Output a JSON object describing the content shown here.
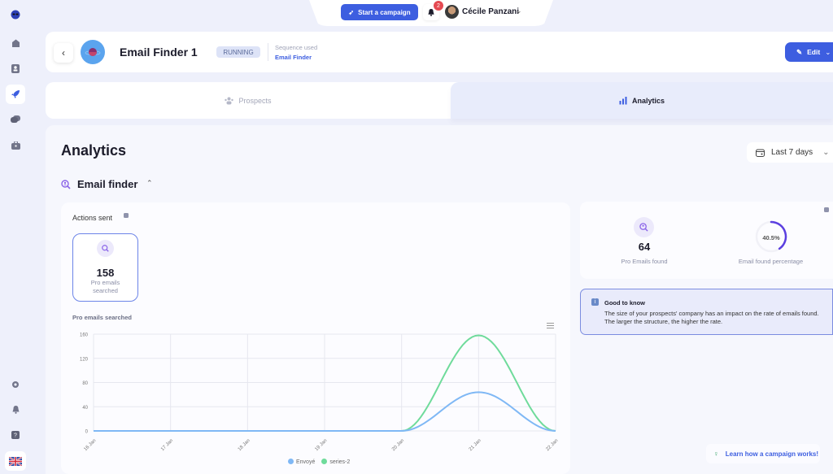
{
  "sidebar": {
    "items": [
      {
        "name": "logo-icon"
      },
      {
        "name": "home-icon"
      },
      {
        "name": "contacts-icon"
      },
      {
        "name": "campaigns-icon",
        "active": true
      },
      {
        "name": "messages-icon"
      },
      {
        "name": "toolbox-icon"
      }
    ],
    "bottom": [
      {
        "name": "settings-icon"
      },
      {
        "name": "notifications-icon"
      },
      {
        "name": "help-icon"
      },
      {
        "name": "language-flag-icon"
      }
    ]
  },
  "topbar": {
    "start_campaign_label": "Start a campaign",
    "notification_count": "2",
    "user_name": "Cécile Panzani"
  },
  "header": {
    "campaign_title": "Email Finder 1",
    "status": "RUNNING",
    "sequence_label": "Sequence used",
    "sequence_value": "Email Finder",
    "edit_label": "Edit"
  },
  "tabs": [
    {
      "label": "Prospects",
      "active": false
    },
    {
      "label": "Analytics",
      "active": true
    }
  ],
  "analytics": {
    "title": "Analytics",
    "date_range": "Last 7 days",
    "section_title": "Email finder",
    "actions_sent_title": "Actions sent",
    "stat": {
      "value": "158",
      "label": "Pro emails searched"
    },
    "chart_title": "Pro emails searched"
  },
  "summary": {
    "found_value": "64",
    "found_label": "Pro Emails found",
    "percentage_value": 40.5,
    "percentage_text": "40.5%",
    "percentage_label": "Email found percentage",
    "ring_color": "#5b3fe0"
  },
  "good_to_know": {
    "title": "Good to know",
    "text": "The size of your prospects' company has an impact on the rate of emails found. The larger the structure, the higher the rate."
  },
  "learn_link": "Learn how a campaign works!",
  "chart_data": {
    "type": "area",
    "title": "Pro emails searched",
    "x": [
      "16 Jan",
      "17 Jan",
      "18 Jan",
      "19 Jan",
      "20 Jan",
      "21 Jan",
      "22 Jan"
    ],
    "series": [
      {
        "name": "Envoyé",
        "color": "#7fb8f5",
        "values": [
          0,
          0,
          0,
          0,
          0,
          64,
          0
        ]
      },
      {
        "name": "series-2",
        "color": "#6fdb9b",
        "values": [
          0,
          0,
          0,
          0,
          0,
          158,
          0
        ]
      }
    ],
    "yticks": [
      0,
      40,
      80,
      120,
      160
    ],
    "ylim": [
      0,
      160
    ],
    "grid": true,
    "legend": "bottom-center",
    "xlabel": "",
    "ylabel": ""
  }
}
